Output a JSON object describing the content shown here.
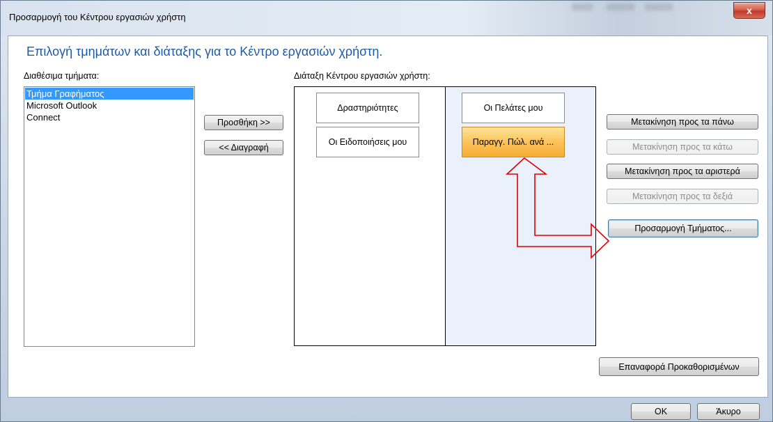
{
  "window": {
    "title": "Προσαρμογή του Κέντρου εργασιών χρήστη",
    "close_label": "x"
  },
  "main": {
    "heading": "Επιλογή τμημάτων και διάταξης για το Κέντρο εργασιών χρήστη.",
    "available_label": "Διαθέσιμα τμήματα:",
    "available_items": [
      {
        "label": "Τμήμα Γραφήματος",
        "selected": true
      },
      {
        "label": "Microsoft Outlook",
        "selected": false
      },
      {
        "label": "Connect",
        "selected": false
      }
    ],
    "add_button": "Προσθήκη >>",
    "remove_button": "<< Διαγραφή",
    "layout_label": "Διάταξη Κέντρου εργασιών χρήστη:",
    "left_column": [
      "Δραστηριότητες",
      "Οι Ειδοποιήσεις μου"
    ],
    "right_column": [
      "Οι Πελάτες μου",
      "Παραγγ. Πώλ. ανά ..."
    ],
    "move_up": "Μετακίνηση προς τα πάνω",
    "move_down": "Μετακίνηση προς τα κάτω",
    "move_left": "Μετακίνηση προς τα αριστερά",
    "move_right": "Μετακίνηση προς τα δεξιά",
    "customize_part": "Προσαρμογή Τμήματος...",
    "restore_defaults": "Επαναφορά Προκαθορισμένων"
  },
  "footer": {
    "ok": "OK",
    "cancel": "Άκυρο"
  },
  "colors": {
    "heading": "#1e5aa8",
    "selection": "#3399ff",
    "active_tile": "#fbc35a",
    "annotation_arrow": "#e00000"
  }
}
